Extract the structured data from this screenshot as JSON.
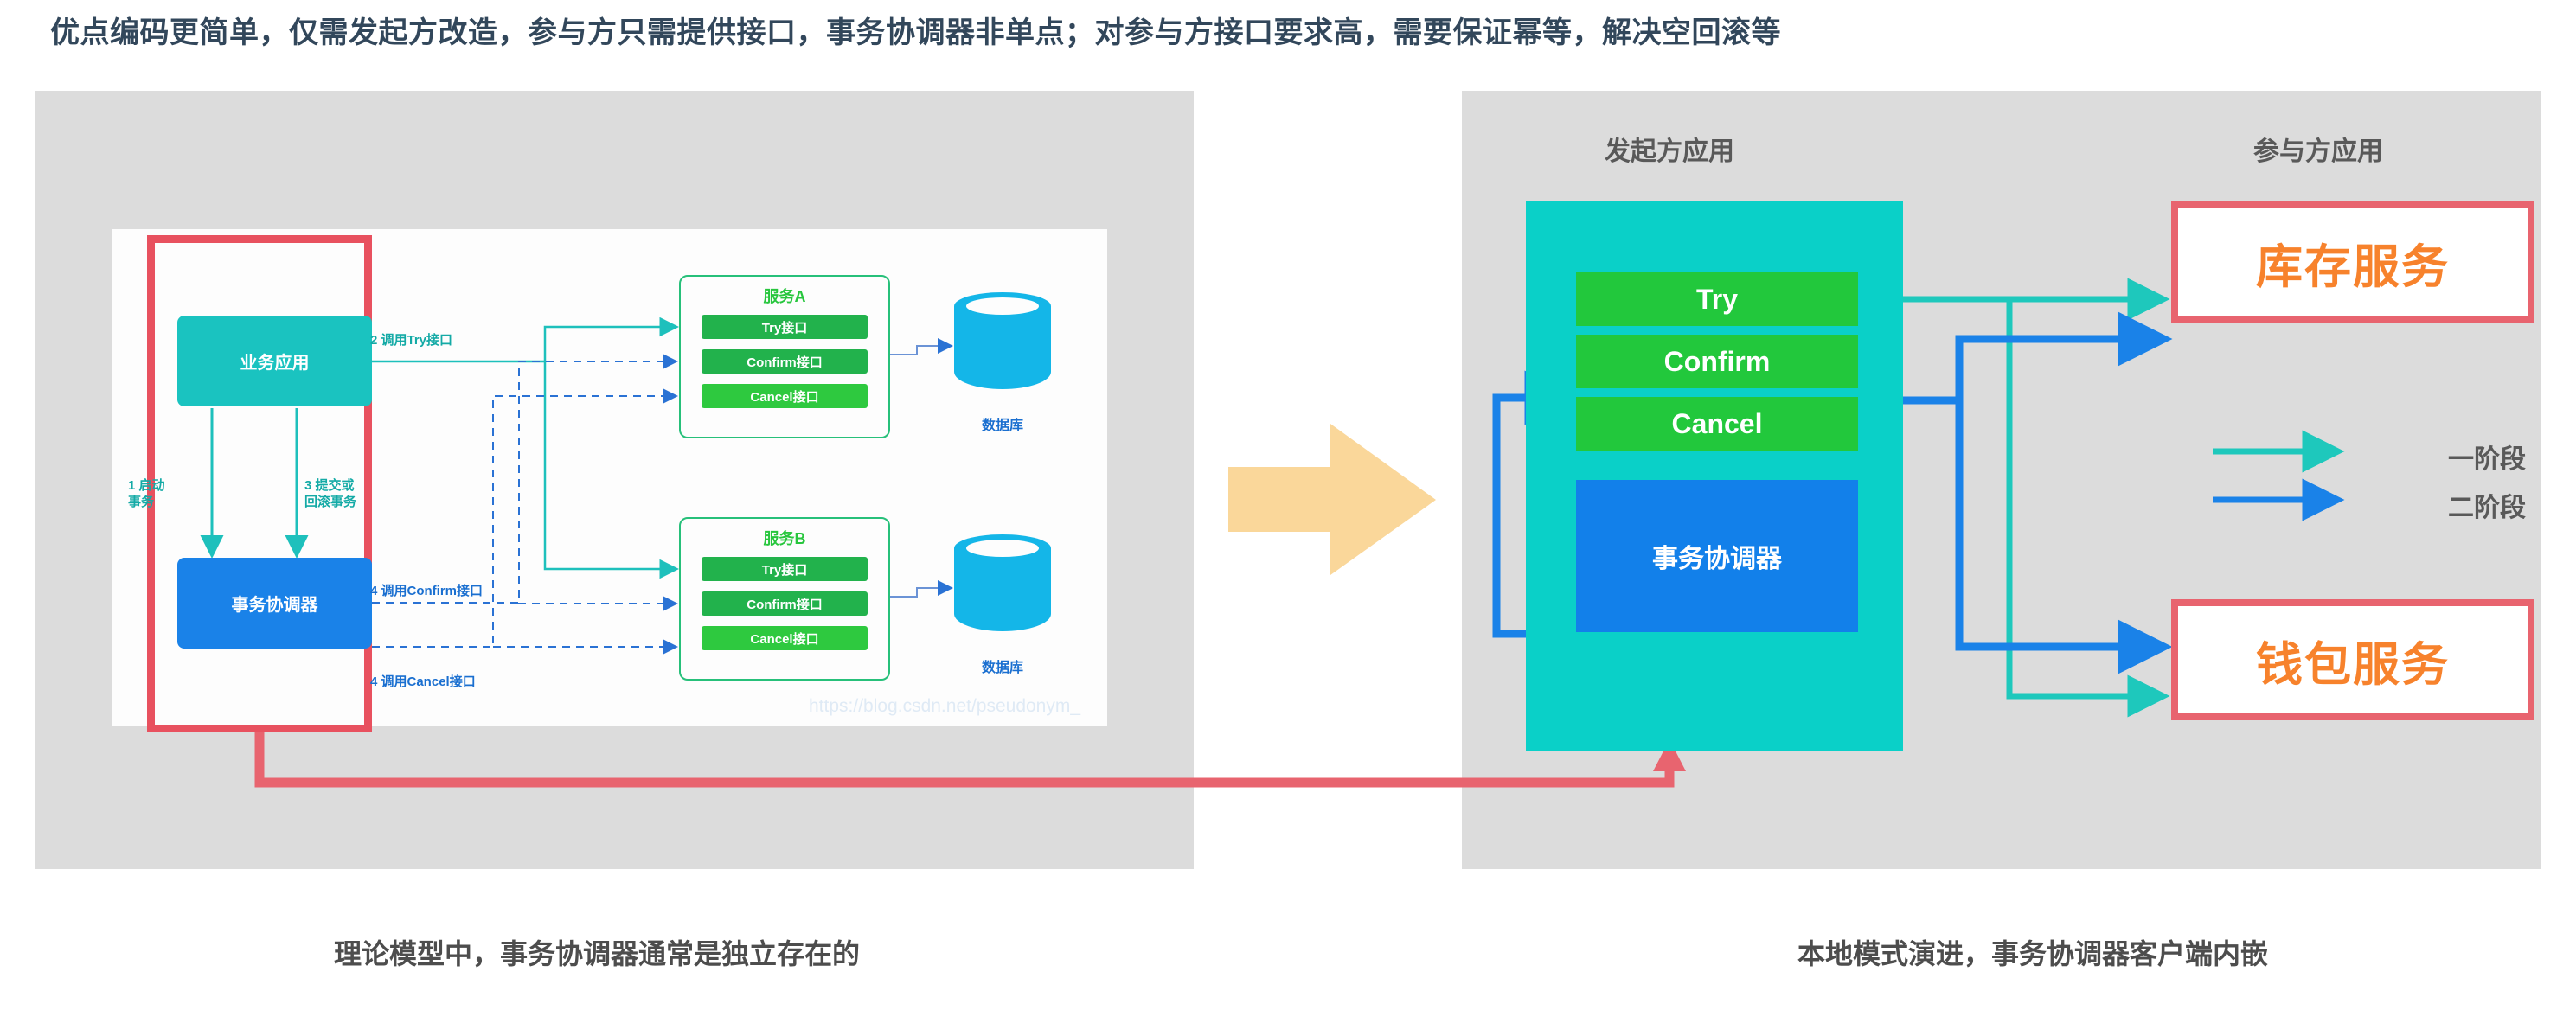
{
  "headline": "优点编码更简单，仅需发起方改造，参与方只需提供接口，事务协调器非单点；对参与方接口要求高，需要保证幂等，解决空回滚等",
  "colors": {
    "panel_bg": "#dcdcdc",
    "teal": "#1ac3c0",
    "teal_container": "#0ad0c8",
    "blue": "#1a82e8",
    "green": "#22c83c",
    "red_frame": "#e8515f",
    "orange_text": "#f7822c",
    "orange_arrow": "#fad79a",
    "phase1_line": "#1ec8bc",
    "phase2_line": "#1a82e8"
  },
  "left_diagram": {
    "biz_app": "业务应用",
    "coordinator": "事务协调器",
    "labels": {
      "call_try": "2 调用Try接口",
      "start_tx": "1 启动\n事务",
      "commit_or_rollback": "3 提交或\n回滚事务",
      "call_confirm": "4 调用Confirm接口",
      "call_cancel": "4 调用Cancel接口"
    },
    "services": [
      {
        "title": "服务A",
        "interfaces": [
          "Try接口",
          "Confirm接口",
          "Cancel接口"
        ],
        "database": "数据库"
      },
      {
        "title": "服务B",
        "interfaces": [
          "Try接口",
          "Confirm接口",
          "Cancel接口"
        ],
        "database": "数据库"
      }
    ],
    "watermark": "https://blog.csdn.net/pseudonym_"
  },
  "right_diagram": {
    "initiator_title": "发起方应用",
    "participant_title": "参与方应用",
    "app_boxes": [
      "Try",
      "Confirm",
      "Cancel"
    ],
    "coordinator": "事务协调器",
    "participant_services": [
      "库存服务",
      "钱包服务"
    ],
    "legend": [
      {
        "label": "一阶段",
        "color": "#1ec8bc"
      },
      {
        "label": "二阶段",
        "color": "#1a82e8"
      }
    ]
  },
  "captions": {
    "left": "理论模型中，事务协调器通常是独立存在的",
    "right": "本地模式演进，事务协调器客户端内嵌"
  }
}
